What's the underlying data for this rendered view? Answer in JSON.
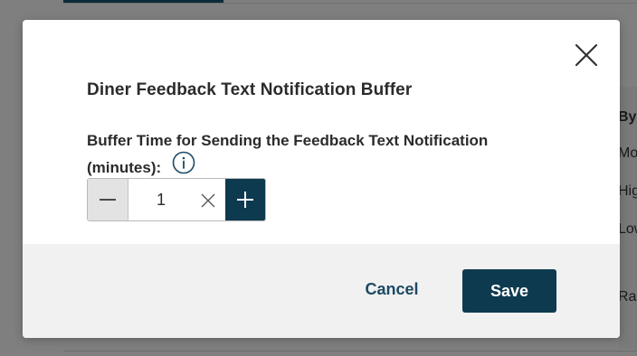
{
  "modal": {
    "title": "Diner Feedback Text Notification Buffer",
    "field_label": "Buffer Time for Sending the Feedback Text Notification (minutes):",
    "stepper": {
      "value": "1"
    },
    "cancel_label": "Cancel",
    "save_label": "Save"
  },
  "background": {
    "partial_texts": [
      "By",
      "Mo",
      "Hig",
      "Low",
      "Ra"
    ]
  },
  "colors": {
    "accent": "#0e3a4f",
    "link": "#1c4a63",
    "footer_bg": "#f1f1f1",
    "overlay": "#7f7f7f"
  },
  "icons": [
    "close-icon",
    "info-icon",
    "minus-icon",
    "clear-icon",
    "plus-icon"
  ]
}
